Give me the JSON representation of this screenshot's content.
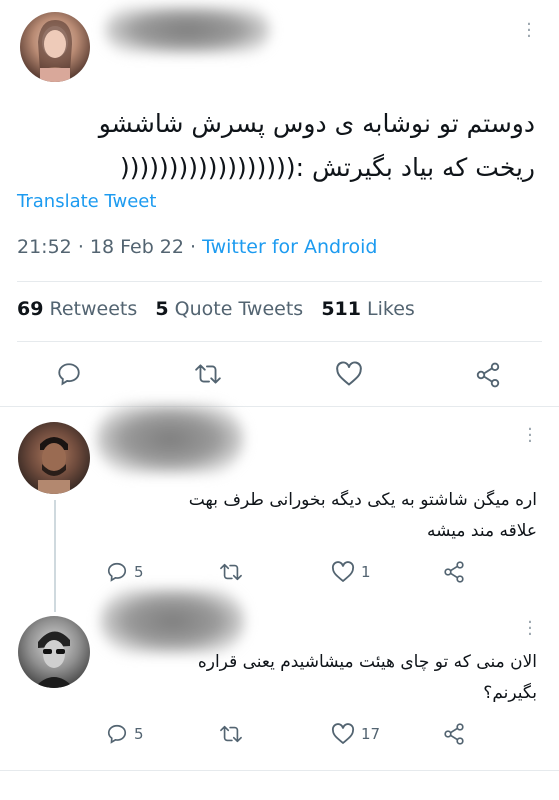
{
  "main_tweet": {
    "text_line1": "دوستم تو نوشابه ی دوس پسرش شاششو",
    "text_line2": "ریخت که بیاد بگیرتش :((((((((((((((((((",
    "translate": "Translate Tweet",
    "time": "21:52",
    "date": "18 Feb 22",
    "source": "Twitter for Android",
    "sep": "·",
    "retweets_count": "69",
    "retweets_label": "Retweets",
    "quotes_count": "5",
    "quotes_label": "Quote Tweets",
    "likes_count": "511",
    "likes_label": "Likes"
  },
  "replies": [
    {
      "text_line1": "اره میگن شاشتو به یکی دیگه بخورانی طرف بهت",
      "text_line2": "علاقه مند میشه",
      "replies": "5",
      "likes": "1"
    },
    {
      "text_line1": "الان منی که تو چای هیئت میشاشیدم یعنی قراره",
      "text_line2": "بگیرنم؟",
      "replies": "5",
      "likes": "17"
    }
  ],
  "colors": {
    "link": "#1d9bf0",
    "muted": "#536471",
    "divider": "#e6eaed"
  }
}
